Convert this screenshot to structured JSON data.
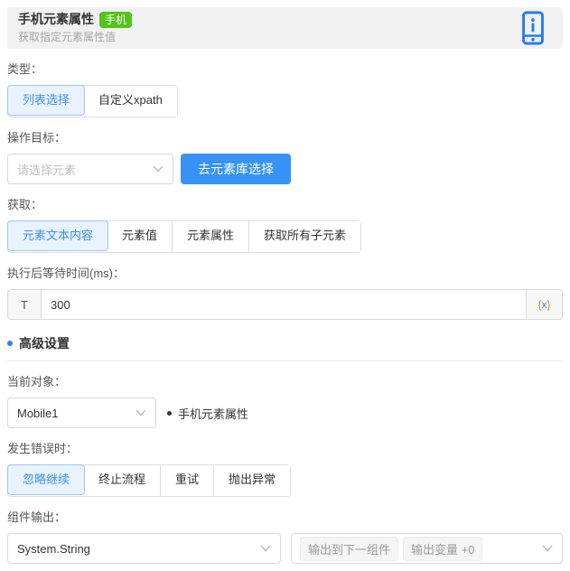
{
  "header": {
    "title": "手机元素属性",
    "badge": "手机",
    "subtitle": "获取指定元素属性值",
    "icon": "mobile-info-icon"
  },
  "type_section": {
    "label": "类型：",
    "options": [
      {
        "label": "列表选择",
        "selected": true
      },
      {
        "label": "自定义xpath",
        "selected": false
      }
    ]
  },
  "target_section": {
    "label": "操作目标：",
    "select_placeholder": "请选择元素",
    "button_label": "去元素库选择"
  },
  "fetch_section": {
    "label": "获取：",
    "options": [
      {
        "label": "元素文本内容",
        "selected": true
      },
      {
        "label": "元素值",
        "selected": false
      },
      {
        "label": "元素属性",
        "selected": false
      },
      {
        "label": "获取所有子元素",
        "selected": false
      }
    ]
  },
  "wait_section": {
    "label": "执行后等待时间(ms)：",
    "prefix": "T",
    "value": "300",
    "suffix_open": "{",
    "suffix_var": "x",
    "suffix_close": "}"
  },
  "advanced": {
    "title": "高级设置"
  },
  "current_object_section": {
    "label": "当前对象：",
    "select_value": "Mobile1",
    "hint": "手机元素属性"
  },
  "error_section": {
    "label": "发生错误时：",
    "options": [
      {
        "label": "忽略继续",
        "selected": true
      },
      {
        "label": "终止流程",
        "selected": false
      },
      {
        "label": "重试",
        "selected": false
      },
      {
        "label": "抛出异常",
        "selected": false
      }
    ]
  },
  "output_section": {
    "label": "组件输出：",
    "select_value": "System.String",
    "tags": [
      "输出到下一组件",
      "输出变量 +0"
    ]
  },
  "colors": {
    "accent_blue": "#3693f5",
    "badge_green": "#52c41a",
    "selected_bg": "#e9f3fe",
    "icon_blue": "#1f7bf4"
  }
}
